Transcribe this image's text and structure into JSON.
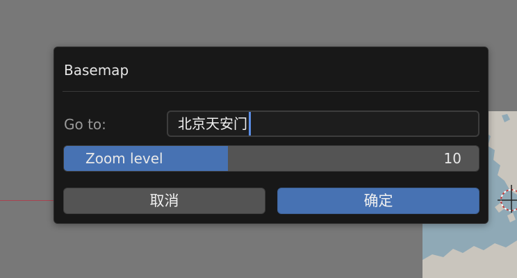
{
  "dialog": {
    "title": "Basemap",
    "goto": {
      "label": "Go to:",
      "value": "北京天安门"
    },
    "zoom": {
      "label": "Zoom level",
      "value": "10",
      "fill_fraction": 0.395
    },
    "buttons": {
      "cancel": "取消",
      "ok": "确定"
    }
  },
  "colors": {
    "viewport_bg": "#787878",
    "dialog_bg": "#181818",
    "accent": "#4772b3",
    "axis_line": "#b23a48",
    "map_water": "#8fa9b6",
    "map_land": "#c9c5bd"
  }
}
